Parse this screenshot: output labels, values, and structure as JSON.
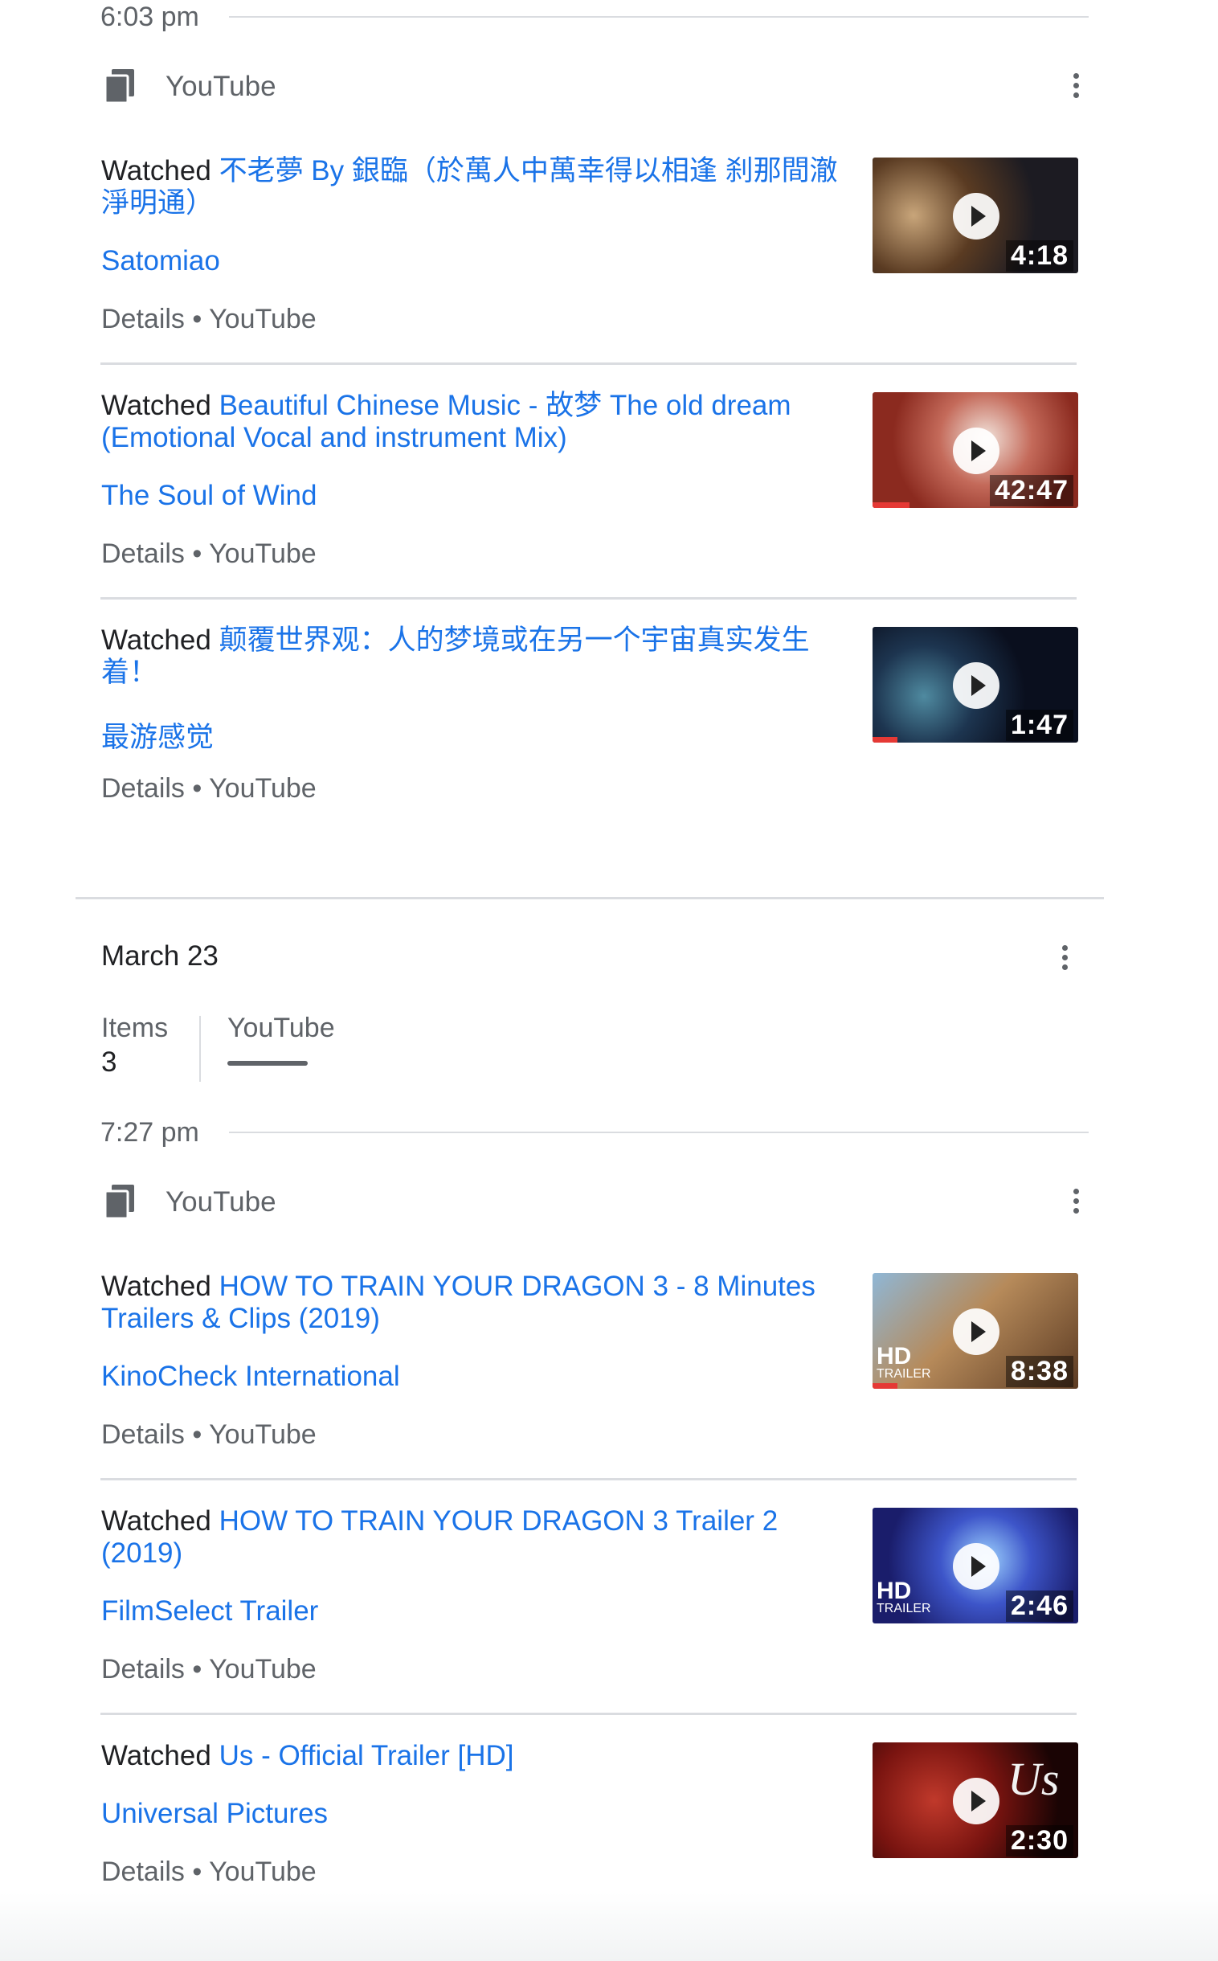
{
  "group1": {
    "time": "6:03 pm",
    "product": "YouTube",
    "items": [
      {
        "prefix": "Watched",
        "title": "不老夢 By 銀臨（於萬人中萬幸得以相逢 刹那間澈淨明通）",
        "channel": "Satomiao",
        "details": "Details • YouTube",
        "duration": "4:18",
        "progress": 0
      },
      {
        "prefix": "Watched",
        "title": "Beautiful Chinese Music - 故梦 The old dream (Emotional Vocal and instrument Mix)",
        "channel": "The Soul of Wind",
        "details": "Details • YouTube",
        "duration": "42:47",
        "progress": 0.18
      },
      {
        "prefix": "Watched",
        "title": "颠覆世界观：人的梦境或在另一个宇宙真实发生着！",
        "channel": "最游感觉",
        "details": "Details • YouTube",
        "duration": "1:47",
        "progress": 0.12
      }
    ]
  },
  "day": {
    "date": "March 23",
    "items_label": "Items",
    "items_count": "3",
    "tab": "YouTube"
  },
  "group2": {
    "time": "7:27 pm",
    "product": "YouTube",
    "items": [
      {
        "prefix": "Watched",
        "title": "HOW TO TRAIN YOUR DRAGON 3 - 8 Minutes Trailers & Clips (2019)",
        "channel": "KinoCheck International",
        "details": "Details • YouTube",
        "duration": "8:38",
        "progress": 0.12,
        "badge": "HD",
        "badge_sub": "TRAILER"
      },
      {
        "prefix": "Watched",
        "title": "HOW TO TRAIN YOUR DRAGON 3 Trailer 2 (2019)",
        "channel": "FilmSelect Trailer",
        "details": "Details • YouTube",
        "duration": "2:46",
        "progress": 0,
        "badge": "HD",
        "badge_sub": "TRAILER"
      },
      {
        "prefix": "Watched",
        "title": "Us - Official Trailer [HD]",
        "channel": "Universal Pictures",
        "details": "Details • YouTube",
        "duration": "2:30",
        "progress": 0,
        "thumb_text": "Us"
      }
    ]
  },
  "colors": {
    "link": "#1a73e8",
    "text": "#202124",
    "secondary": "#5f6368",
    "divider": "#dadce0",
    "progress": "#e53935"
  },
  "icons": {
    "product": "youtube-product-icon",
    "more": "more-vert-icon",
    "play": "play-icon"
  }
}
